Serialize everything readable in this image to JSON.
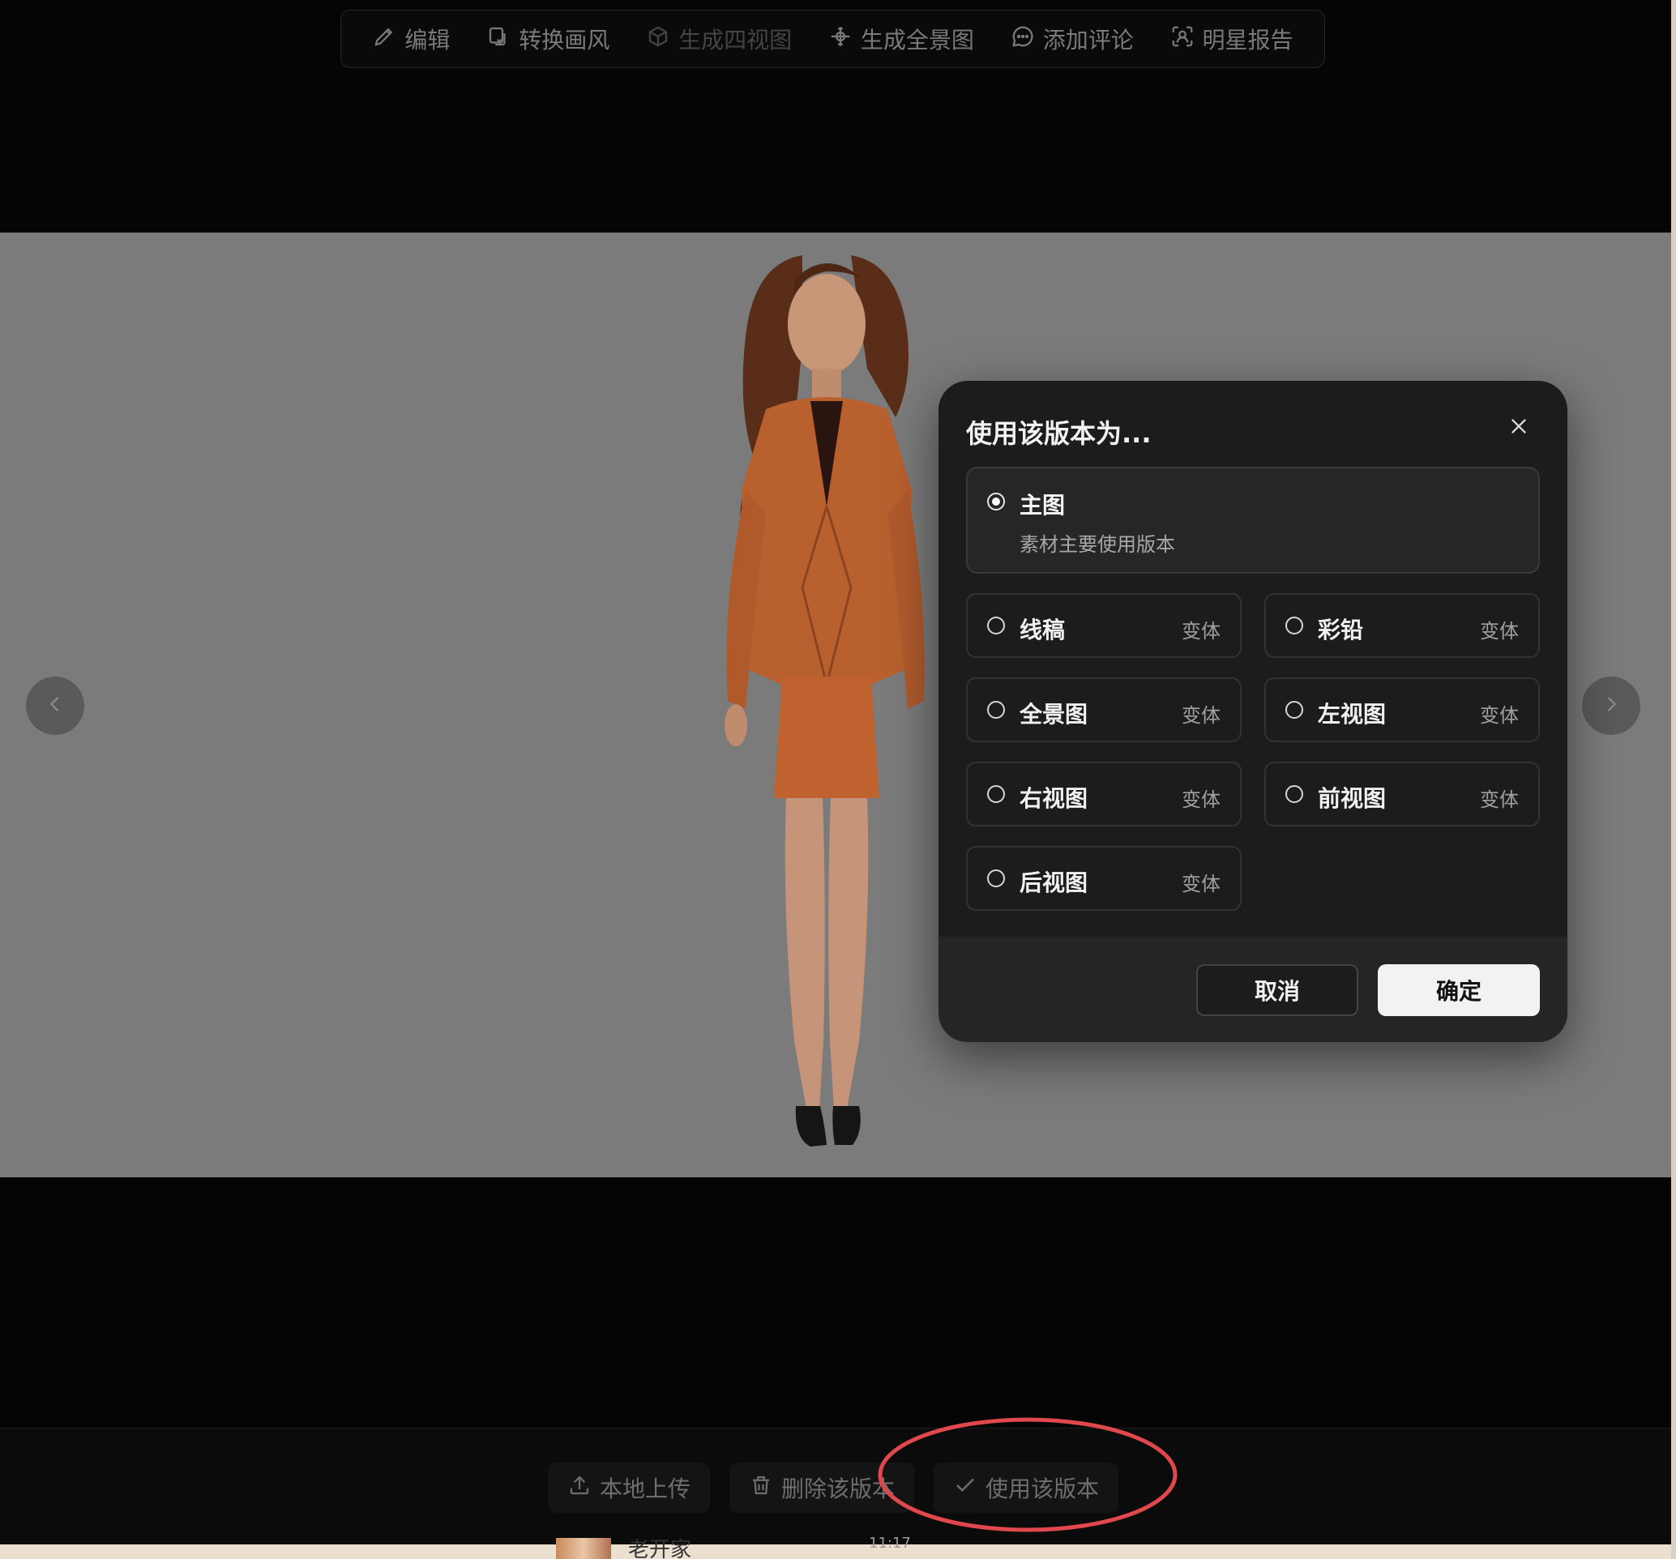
{
  "toolbar": {
    "items": [
      {
        "label": "编辑",
        "icon": "pencil-icon",
        "disabled": false
      },
      {
        "label": "转换画风",
        "icon": "style-transfer-icon",
        "disabled": false
      },
      {
        "label": "生成四视图",
        "icon": "cube-icon",
        "disabled": true
      },
      {
        "label": "生成全景图",
        "icon": "panorama-icon",
        "disabled": false
      },
      {
        "label": "添加评论",
        "icon": "comment-icon",
        "disabled": false
      },
      {
        "label": "明星报告",
        "icon": "face-scan-icon",
        "disabled": false
      }
    ]
  },
  "modal": {
    "title": "使用该版本为...",
    "main_option": {
      "label": "主图",
      "description": "素材主要使用版本",
      "selected": true
    },
    "options": [
      {
        "label": "线稿",
        "tag": "变体"
      },
      {
        "label": "彩铅",
        "tag": "变体"
      },
      {
        "label": "全景图",
        "tag": "变体"
      },
      {
        "label": "左视图",
        "tag": "变体"
      },
      {
        "label": "右视图",
        "tag": "变体"
      },
      {
        "label": "前视图",
        "tag": "变体"
      },
      {
        "label": "后视图",
        "tag": "变体"
      }
    ],
    "cancel_label": "取消",
    "confirm_label": "确定"
  },
  "bottom_bar": {
    "upload_label": "本地上传",
    "delete_label": "删除该版本",
    "use_label": "使用该版本"
  },
  "underlying": {
    "text": "老开家",
    "time": "11:17"
  },
  "colors": {
    "annotation": "#e0484e",
    "stage_bg": "#7b7b7b",
    "suit": "#c8663a"
  }
}
